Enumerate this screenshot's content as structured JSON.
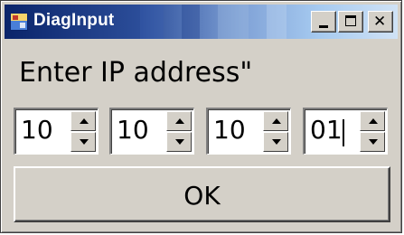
{
  "window": {
    "title": "DiagInput",
    "close_glyph": "✕",
    "icons": {
      "app": "app-icon",
      "minimize": "minimize-icon",
      "maximize": "maximize-icon",
      "close": "close-icon"
    }
  },
  "dialog": {
    "prompt": "Enter IP address\"",
    "octets": [
      "10",
      "10",
      "10",
      "01"
    ],
    "focused_octet_index": 3,
    "ok_label": "OK"
  },
  "colors": {
    "face": "#d4d0c8",
    "title_start": "#0a246a",
    "title_end": "#a6caf0",
    "title_text": "#ffffff"
  }
}
